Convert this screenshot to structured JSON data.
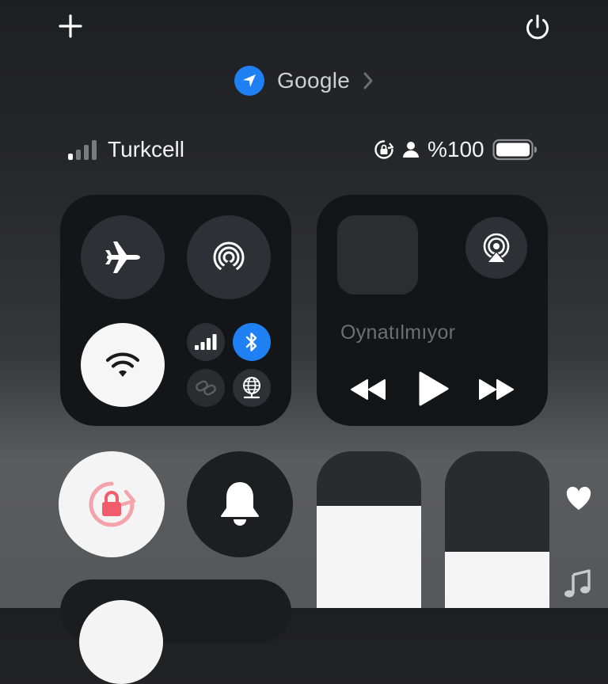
{
  "header": {
    "add_icon": "plus-icon",
    "power_icon": "power-icon"
  },
  "location": {
    "app_name": "Google",
    "icon": "location-arrow-icon"
  },
  "status": {
    "carrier": "Turkcell",
    "battery_percent": "%100",
    "signal_bars": 1,
    "signal_total": 4
  },
  "connectivity": {
    "airplane_mode": false,
    "airdrop": false,
    "wifi": true,
    "cellular": false,
    "bluetooth": true,
    "personal_hotspot": false,
    "vpn": false
  },
  "media": {
    "now_playing": "Oynatılmıyor"
  },
  "sliders": {
    "brightness_level": 0.65,
    "volume_level": 0.36
  },
  "colors": {
    "accent_blue": "#1e80f2",
    "lock_red": "#f25c6a",
    "tile_bg": "#141518"
  }
}
